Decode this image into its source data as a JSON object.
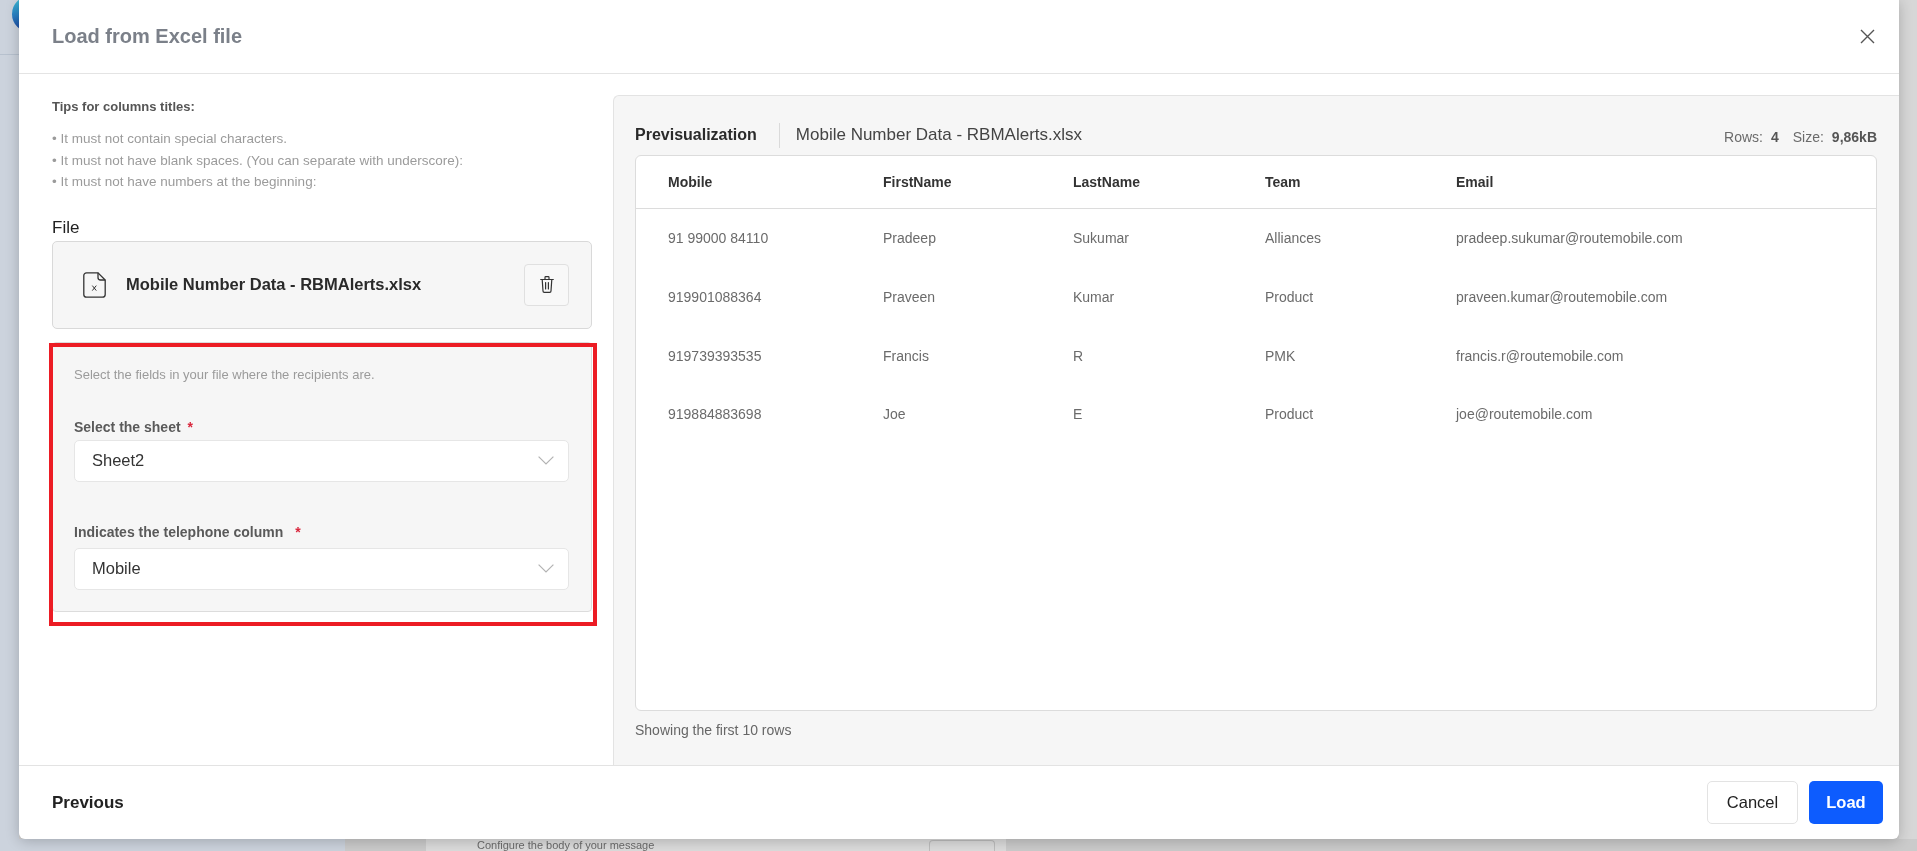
{
  "background": {
    "text": "Configure the body of your message"
  },
  "dialog": {
    "title": "Load from Excel file"
  },
  "tips": {
    "title": "Tips for columns titles:",
    "items": [
      "• It must not contain special characters.",
      "• It must not have blank spaces. (You can separate with underscore):",
      "• It must not have numbers at the beginning:"
    ]
  },
  "file": {
    "label": "File",
    "name": "Mobile Number Data - RBMAlerts.xlsx"
  },
  "recipients": {
    "hint": "Select the fields in your file where the recipients are.",
    "fields": [
      {
        "label": "Select the sheet",
        "required_mark": "*",
        "value": "Sheet2"
      },
      {
        "label": "Indicates the telephone column",
        "required_mark": "*",
        "value": "Mobile"
      }
    ]
  },
  "preview": {
    "title": "Previsualization",
    "file_name": "Mobile Number Data - RBMAlerts.xlsx",
    "stats": [
      {
        "label": "Rows:",
        "value": "4"
      },
      {
        "label": "Size:",
        "value": "9,86kB"
      }
    ],
    "table": {
      "columns": [
        "Mobile",
        "FirstName",
        "LastName",
        "Team",
        "Email"
      ],
      "rows": [
        [
          "91 99000 84110",
          "Pradeep",
          "Sukumar",
          "Alliances",
          "pradeep.sukumar@routemobile.com"
        ],
        [
          "919901088364",
          "Praveen",
          "Kumar",
          "Product",
          "praveen.kumar@routemobile.com"
        ],
        [
          "919739393535",
          "Francis",
          "R",
          "PMK",
          "francis.r@routemobile.com"
        ],
        [
          "919884883698",
          "Joe",
          "E",
          "Product",
          "joe@routemobile.com"
        ]
      ]
    },
    "footnote": "Showing the first 10 rows"
  },
  "footer": {
    "previous": "Previous",
    "buttons": [
      {
        "label": "Cancel",
        "kind": "secondary"
      },
      {
        "label": "Load",
        "kind": "primary"
      }
    ]
  }
}
